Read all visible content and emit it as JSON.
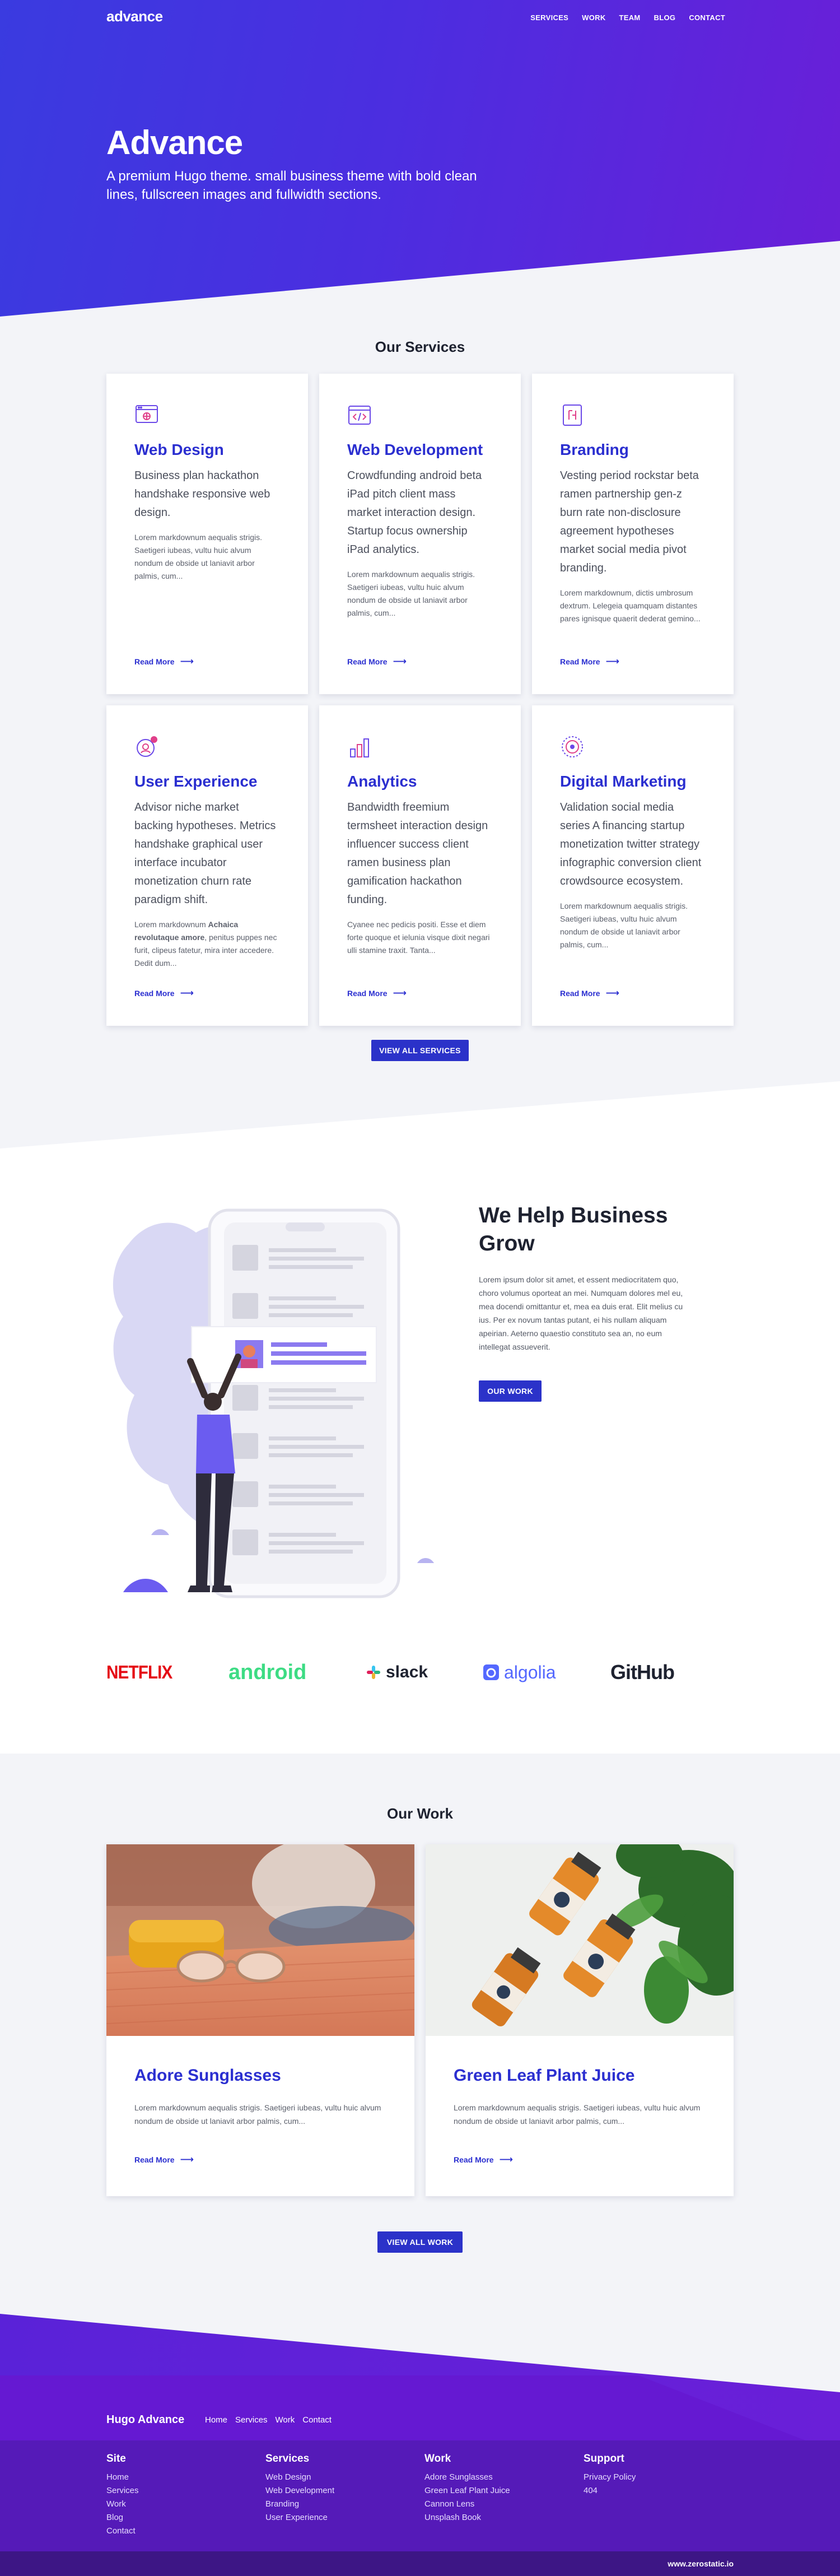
{
  "nav": {
    "logo": "advance",
    "links": [
      "SERVICES",
      "WORK",
      "TEAM",
      "BLOG",
      "CONTACT"
    ]
  },
  "hero": {
    "title": "Advance",
    "subtitle": "A premium Hugo theme. small business theme with bold clean lines, fullscreen images and fullwidth sections."
  },
  "services": {
    "title": "Our Services",
    "items": [
      {
        "icon": "web-design-icon",
        "title": "Web Design",
        "lead": "Business plan hackathon handshake responsive web design.",
        "text": "Lorem markdownum aequalis strigis. Saetigeri iubeas, vultu huic alvum nondum de obside ut laniavit arbor palmis, cum...",
        "link": "Read More"
      },
      {
        "icon": "code-window-icon",
        "title": "Web Development",
        "lead": "Crowdfunding android beta iPad pitch client mass market interaction design. Startup focus ownership iPad analytics.",
        "text": "Lorem markdownum aequalis strigis. Saetigeri iubeas, vultu huic alvum nondum de obside ut laniavit arbor palmis, cum...",
        "link": "Read More"
      },
      {
        "icon": "branding-icon",
        "title": "Branding",
        "lead": "Vesting period rockstar beta ramen partnership gen-z burn rate non-disclosure agreement hypotheses market social media pivot branding.",
        "text": "Lorem markdownum, dictis umbrosum dextrum. Lelegeia quamquam distantes pares ignisque quaerit dederat gemino...",
        "link": "Read More"
      },
      {
        "icon": "user-experience-icon",
        "title": "User Experience",
        "lead": "Advisor niche market backing hypotheses. Metrics handshake graphical user interface incubator monetization churn rate paradigm shift.",
        "text_pre": "Lorem markdownum ",
        "text_bold": "Achaica revolutaque amore",
        "text_post": ", penitus puppes nec furit, clipeus fatetur, mira inter accedere. Dedit dum...",
        "link": "Read More"
      },
      {
        "icon": "analytics-icon",
        "title": "Analytics",
        "lead": "Bandwidth freemium termsheet interaction design influencer success client ramen business plan gamification hackathon funding.",
        "text": "Cyanee nec pedicis positi. Esse et diem forte quoque et ielunia visque dixit negari ulli stamine traxit. Tanta...",
        "link": "Read More"
      },
      {
        "icon": "digital-marketing-icon",
        "title": "Digital Marketing",
        "lead": "Validation social media series A financing startup monetization twitter strategy infographic conversion client crowdsource ecosystem.",
        "text": "Lorem markdownum aequalis strigis. Saetigeri iubeas, vultu huic alvum nondum de obside ut laniavit arbor palmis, cum...",
        "link": "Read More"
      }
    ],
    "button": "VIEW ALL SERVICES"
  },
  "grow": {
    "title": "We Help Business Grow",
    "text": "Lorem ipsum dolor sit amet, et essent mediocritatem quo, choro volumus oporteat an mei. Numquam dolores mel eu, mea docendi omittantur et, mea ea duis erat. Elit melius cu ius. Per ex novum tantas putant, ei his nullam aliquam apeirian. Aeterno quaestio constituto sea an, no eum intellegat assueverit.",
    "button": "OUR WORK"
  },
  "logos": [
    "NETFLIX",
    "android",
    "slack",
    "algolia",
    "GitHub"
  ],
  "colors": {
    "netflix": "#e50914",
    "android": "#3ddc84",
    "slack": "#1e2230",
    "algolia": "#5468ff",
    "github": "#1e2230",
    "accent": "#2b2fd0"
  },
  "work": {
    "title": "Our Work",
    "items": [
      {
        "title": "Adore Sunglasses",
        "text": "Lorem markdownum aequalis strigis. Saetigeri iubeas, vultu huic alvum nondum de obside ut laniavit arbor palmis, cum...",
        "link": "Read More"
      },
      {
        "title": "Green Leaf Plant Juice",
        "text": "Lorem markdownum aequalis strigis. Saetigeri iubeas, vultu huic alvum nondum de obside ut laniavit arbor palmis, cum...",
        "link": "Read More"
      }
    ],
    "button": "VIEW ALL WORK"
  },
  "footer": {
    "brand": "Hugo Advance",
    "nav": [
      "Home",
      "Services",
      "Work",
      "Contact"
    ],
    "columns": [
      {
        "title": "Site",
        "links": [
          "Home",
          "Services",
          "Work",
          "Blog",
          "Contact"
        ]
      },
      {
        "title": "Services",
        "links": [
          "Web Design",
          "Web Development",
          "Branding",
          "User Experience"
        ]
      },
      {
        "title": "Work",
        "links": [
          "Adore Sunglasses",
          "Green Leaf Plant Juice",
          "Cannon Lens",
          "Unsplash Book"
        ]
      },
      {
        "title": "Support",
        "links": [
          "Privacy Policy",
          "404"
        ]
      }
    ],
    "credit": "www.zerostatic.io"
  }
}
